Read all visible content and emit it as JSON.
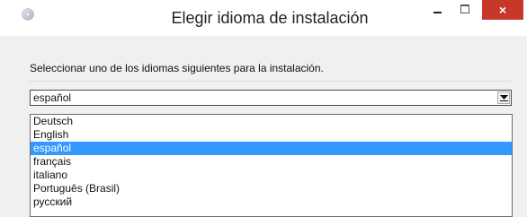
{
  "window": {
    "title": "Elegir idioma de instalación",
    "app_icon": "cd-disc-icon",
    "controls": {
      "minimize": "minimize-icon",
      "maximize": "maximize-icon",
      "close": "×"
    }
  },
  "dialog": {
    "instruction": "Seleccionar uno de los idiomas siguientes para la instalación.",
    "language_select": {
      "value": "español",
      "options": [
        "Deutsch",
        "English",
        "español",
        "français",
        "italiano",
        "Português (Brasil)",
        "русский"
      ],
      "selected_index": 2
    }
  },
  "colors": {
    "selection": "#3399ff",
    "close_button": "#c7382b"
  }
}
